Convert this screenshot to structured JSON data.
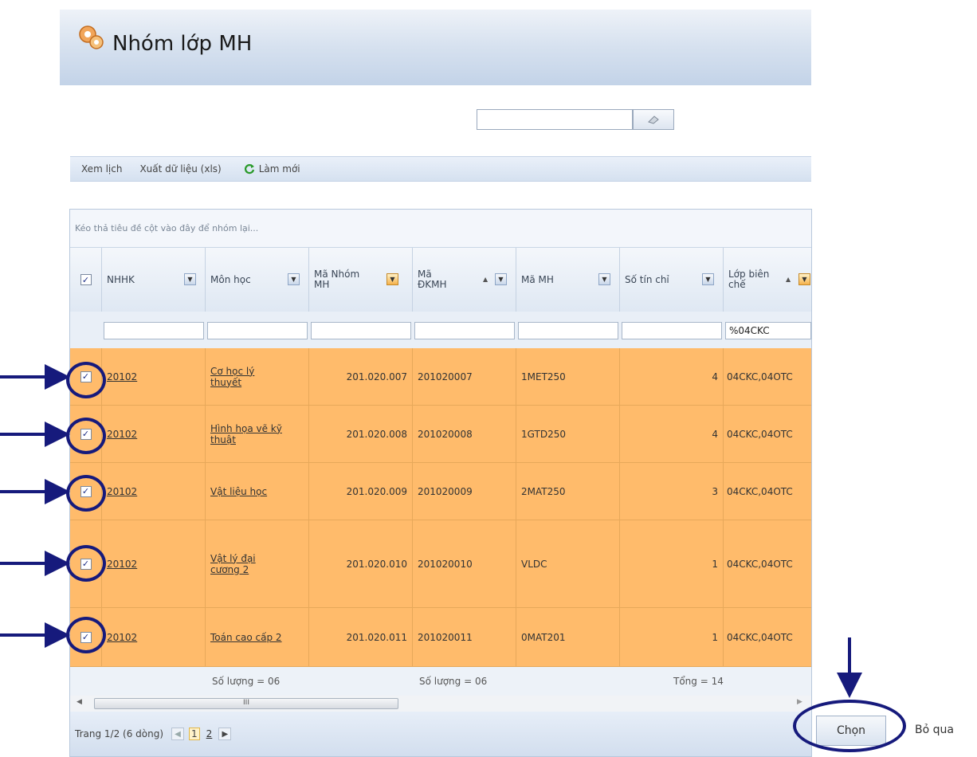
{
  "title": "Nhóm lớp MH",
  "search": {
    "value": "",
    "placeholder": ""
  },
  "toolbar": {
    "view_schedule": "Xem lịch",
    "export": "Xuất dữ liệu (xls)",
    "refresh": "Làm mới"
  },
  "grid": {
    "group_hint": "Kéo thả tiêu đề cột vào đây để nhóm lại...",
    "columns": [
      {
        "label": "NHHK"
      },
      {
        "label": "Môn học"
      },
      {
        "label": "Mã Nhóm MH"
      },
      {
        "label": "Mã ĐKMH"
      },
      {
        "label": "Mã MH"
      },
      {
        "label": "Số tín chỉ"
      },
      {
        "label": "Lớp biên chế"
      }
    ],
    "filter_values": {
      "lop_bien_che": "%04CKC"
    },
    "rows": [
      {
        "checked": true,
        "nhhk": "20102",
        "mon_hoc": "Cơ học lý thuyết",
        "ma_nhom": "201.020.007",
        "ma_dkmh": "201020007",
        "ma_mh": "1MET250",
        "so_tin_chi": "4",
        "lop": "04CKC,04OTC"
      },
      {
        "checked": true,
        "nhhk": "20102",
        "mon_hoc": "Hình họa vẽ kỹ thuật",
        "ma_nhom": "201.020.008",
        "ma_dkmh": "201020008",
        "ma_mh": "1GTD250",
        "so_tin_chi": "4",
        "lop": "04CKC,04OTC"
      },
      {
        "checked": true,
        "nhhk": "20102",
        "mon_hoc": "Vật liệu học",
        "ma_nhom": "201.020.009",
        "ma_dkmh": "201020009",
        "ma_mh": "2MAT250",
        "so_tin_chi": "3",
        "lop": "04CKC,04OTC"
      },
      {
        "checked": true,
        "nhhk": "20102",
        "mon_hoc": "Vật lý đại cương 2",
        "ma_nhom": "201.020.010",
        "ma_dkmh": "201020010",
        "ma_mh": "VLDC",
        "so_tin_chi": "1",
        "lop": "04CKC,04OTC"
      },
      {
        "checked": true,
        "nhhk": "20102",
        "mon_hoc": "Toán cao cấp 2",
        "ma_nhom": "201.020.011",
        "ma_dkmh": "201020011",
        "ma_mh": "0MAT201",
        "so_tin_chi": "1",
        "lop": "04CKC,04OTC"
      }
    ],
    "footer": {
      "mon_hoc_count": "Số lượng = 06",
      "ma_dkmh_count": "Số lượng = 06",
      "tin_chi_total": "Tổng = 14"
    },
    "scroll_thumb_glyph": "III",
    "pager": {
      "info": "Trang 1/2 (6 dòng)",
      "pages": [
        "1",
        "2"
      ],
      "current_page": "1"
    }
  },
  "actions": {
    "choose": "Chọn",
    "skip": "Bỏ qua"
  },
  "colors": {
    "row_highlight": "#ffbb6b",
    "annotation": "#161a7c"
  }
}
